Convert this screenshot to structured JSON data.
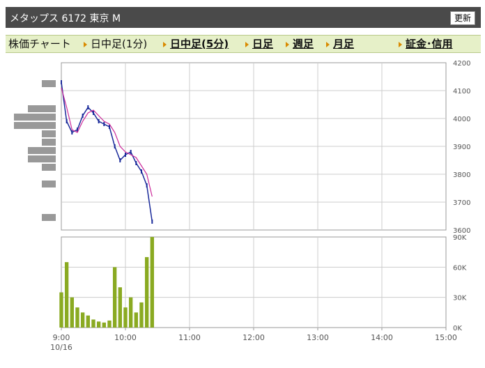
{
  "header": {
    "title": "メタップス  6172  東京 M",
    "refresh_label": "更新"
  },
  "nav": {
    "chart_label": "株価チャート",
    "intraday_1min": "日中足(1分)",
    "intraday_5min": "日中足(5分)",
    "daily": "日足",
    "weekly": "週足",
    "monthly": "月足",
    "margin": "証金･信用"
  },
  "colors": {
    "candle": "#1a2a9a",
    "moving_average": "#cc2a9a",
    "volume": "#8aaa22",
    "volume_profile": "#999999",
    "grid": "#cccccc",
    "axis_text": "#555555"
  },
  "chart_data": [
    {
      "type": "line",
      "title": "",
      "xlabel": "",
      "ylabel": "",
      "x_ticks": [
        "9:00",
        "10:00",
        "11:00",
        "12:00",
        "13:00",
        "14:00",
        "15:00"
      ],
      "x_date_label": "10/16",
      "ylim": [
        3600,
        4200
      ],
      "y_ticks": [
        3600,
        3700,
        3800,
        3900,
        4000,
        4100,
        4200
      ],
      "grid": true,
      "series": [
        {
          "kind": "price",
          "x": [
            "9:00",
            "9:05",
            "9:10",
            "9:15",
            "9:20",
            "9:25",
            "9:30",
            "9:35",
            "9:40",
            "9:45",
            "9:50",
            "9:55",
            "10:00",
            "10:05",
            "10:10",
            "10:15",
            "10:20",
            "10:25"
          ],
          "values": [
            4130,
            3990,
            3950,
            3960,
            4010,
            4040,
            4020,
            3990,
            3980,
            3970,
            3900,
            3850,
            3870,
            3880,
            3840,
            3810,
            3760,
            3630
          ]
        },
        {
          "kind": "moving_average",
          "x": [
            "9:00",
            "9:05",
            "9:10",
            "9:15",
            "9:20",
            "9:25",
            "9:30",
            "9:35",
            "9:40",
            "9:45",
            "9:50",
            "9:55",
            "10:00",
            "10:05",
            "10:10",
            "10:15",
            "10:20",
            "10:25"
          ],
          "values": [
            4110,
            4040,
            3960,
            3950,
            3990,
            4020,
            4030,
            4010,
            3990,
            3980,
            3950,
            3900,
            3880,
            3870,
            3860,
            3830,
            3800,
            3720
          ]
        }
      ]
    },
    {
      "type": "bar",
      "title": "",
      "xlabel": "",
      "ylabel": "",
      "ylim": [
        0,
        90000
      ],
      "y_ticks": [
        "0K",
        "30K",
        "60K",
        "90K"
      ],
      "grid": true,
      "series": [
        {
          "kind": "volume",
          "x": [
            "9:00",
            "9:05",
            "9:10",
            "9:15",
            "9:20",
            "9:25",
            "9:30",
            "9:35",
            "9:40",
            "9:45",
            "9:50",
            "9:55",
            "10:00",
            "10:05",
            "10:10",
            "10:15",
            "10:20",
            "10:25"
          ],
          "values": [
            35000,
            65000,
            30000,
            20000,
            15000,
            12000,
            8000,
            6000,
            5000,
            7000,
            60000,
            40000,
            20000,
            30000,
            15000,
            25000,
            70000,
            90000
          ]
        }
      ]
    }
  ]
}
